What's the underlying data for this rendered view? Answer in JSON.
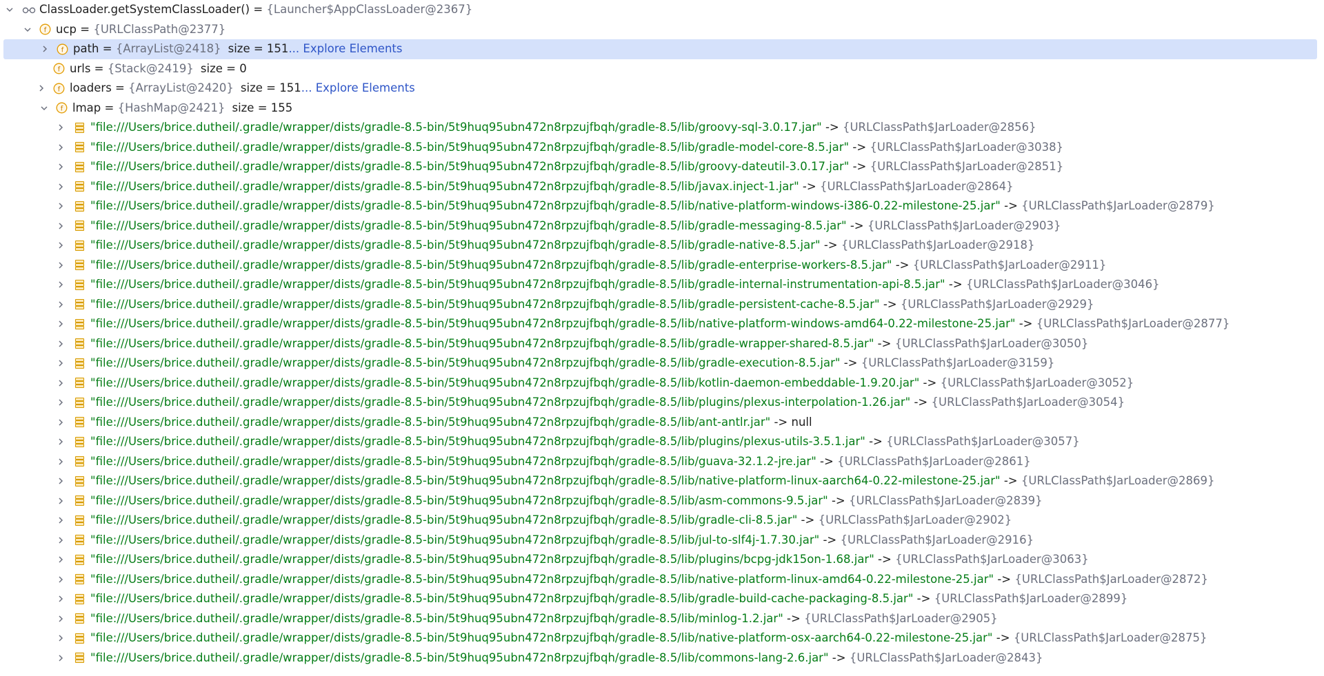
{
  "colors": {
    "selection": "#d5e1fb",
    "string": "#067d17",
    "ref": "#6c707e",
    "link": "#2e55c7",
    "field_icon": "#e39b00",
    "map_icon": "#d79b00"
  },
  "root": {
    "icon": "watch-glasses-icon",
    "name": "ClassLoader.getSystemClassLoader()",
    "eq": " = ",
    "ref": "{Launcher$AppClassLoader@2367}"
  },
  "ucp": {
    "name": "ucp",
    "eq": " = ",
    "ref": "{URLClassPath@2377}"
  },
  "fields": [
    {
      "name": "path",
      "ref": "{ArrayList@2418}",
      "size": "size = 151",
      "link": "... Explore Elements",
      "expandable": true,
      "selected": true
    },
    {
      "name": "urls",
      "ref": "{Stack@2419}",
      "size": "size = 0",
      "link": "",
      "expandable": false,
      "selected": false
    },
    {
      "name": "loaders",
      "ref": "{ArrayList@2420}",
      "size": "size = 151",
      "link": "... Explore Elements",
      "expandable": true,
      "selected": false
    }
  ],
  "lmap": {
    "name": "lmap",
    "eq": " = ",
    "ref": "{HashMap@2421}",
    "size": "size = 155"
  },
  "arrow": " -> ",
  "entries": [
    {
      "key": "\"file:///Users/brice.dutheil/.gradle/wrapper/dists/gradle-8.5-bin/5t9huq95ubn472n8rpzujfbqh/gradle-8.5/lib/groovy-sql-3.0.17.jar\"",
      "value": "{URLClassPath$JarLoader@2856}"
    },
    {
      "key": "\"file:///Users/brice.dutheil/.gradle/wrapper/dists/gradle-8.5-bin/5t9huq95ubn472n8rpzujfbqh/gradle-8.5/lib/gradle-model-core-8.5.jar\"",
      "value": "{URLClassPath$JarLoader@3038}"
    },
    {
      "key": "\"file:///Users/brice.dutheil/.gradle/wrapper/dists/gradle-8.5-bin/5t9huq95ubn472n8rpzujfbqh/gradle-8.5/lib/groovy-dateutil-3.0.17.jar\"",
      "value": "{URLClassPath$JarLoader@2851}"
    },
    {
      "key": "\"file:///Users/brice.dutheil/.gradle/wrapper/dists/gradle-8.5-bin/5t9huq95ubn472n8rpzujfbqh/gradle-8.5/lib/javax.inject-1.jar\"",
      "value": "{URLClassPath$JarLoader@2864}"
    },
    {
      "key": "\"file:///Users/brice.dutheil/.gradle/wrapper/dists/gradle-8.5-bin/5t9huq95ubn472n8rpzujfbqh/gradle-8.5/lib/native-platform-windows-i386-0.22-milestone-25.jar\"",
      "value": "{URLClassPath$JarLoader@2879}"
    },
    {
      "key": "\"file:///Users/brice.dutheil/.gradle/wrapper/dists/gradle-8.5-bin/5t9huq95ubn472n8rpzujfbqh/gradle-8.5/lib/gradle-messaging-8.5.jar\"",
      "value": "{URLClassPath$JarLoader@2903}"
    },
    {
      "key": "\"file:///Users/brice.dutheil/.gradle/wrapper/dists/gradle-8.5-bin/5t9huq95ubn472n8rpzujfbqh/gradle-8.5/lib/gradle-native-8.5.jar\"",
      "value": "{URLClassPath$JarLoader@2918}"
    },
    {
      "key": "\"file:///Users/brice.dutheil/.gradle/wrapper/dists/gradle-8.5-bin/5t9huq95ubn472n8rpzujfbqh/gradle-8.5/lib/gradle-enterprise-workers-8.5.jar\"",
      "value": "{URLClassPath$JarLoader@2911}"
    },
    {
      "key": "\"file:///Users/brice.dutheil/.gradle/wrapper/dists/gradle-8.5-bin/5t9huq95ubn472n8rpzujfbqh/gradle-8.5/lib/gradle-internal-instrumentation-api-8.5.jar\"",
      "value": "{URLClassPath$JarLoader@3046}"
    },
    {
      "key": "\"file:///Users/brice.dutheil/.gradle/wrapper/dists/gradle-8.5-bin/5t9huq95ubn472n8rpzujfbqh/gradle-8.5/lib/gradle-persistent-cache-8.5.jar\"",
      "value": "{URLClassPath$JarLoader@2929}"
    },
    {
      "key": "\"file:///Users/brice.dutheil/.gradle/wrapper/dists/gradle-8.5-bin/5t9huq95ubn472n8rpzujfbqh/gradle-8.5/lib/native-platform-windows-amd64-0.22-milestone-25.jar\"",
      "value": "{URLClassPath$JarLoader@2877}"
    },
    {
      "key": "\"file:///Users/brice.dutheil/.gradle/wrapper/dists/gradle-8.5-bin/5t9huq95ubn472n8rpzujfbqh/gradle-8.5/lib/gradle-wrapper-shared-8.5.jar\"",
      "value": "{URLClassPath$JarLoader@3050}"
    },
    {
      "key": "\"file:///Users/brice.dutheil/.gradle/wrapper/dists/gradle-8.5-bin/5t9huq95ubn472n8rpzujfbqh/gradle-8.5/lib/gradle-execution-8.5.jar\"",
      "value": "{URLClassPath$JarLoader@3159}"
    },
    {
      "key": "\"file:///Users/brice.dutheil/.gradle/wrapper/dists/gradle-8.5-bin/5t9huq95ubn472n8rpzujfbqh/gradle-8.5/lib/kotlin-daemon-embeddable-1.9.20.jar\"",
      "value": "{URLClassPath$JarLoader@3052}"
    },
    {
      "key": "\"file:///Users/brice.dutheil/.gradle/wrapper/dists/gradle-8.5-bin/5t9huq95ubn472n8rpzujfbqh/gradle-8.5/lib/plugins/plexus-interpolation-1.26.jar\"",
      "value": "{URLClassPath$JarLoader@3054}"
    },
    {
      "key": "\"file:///Users/brice.dutheil/.gradle/wrapper/dists/gradle-8.5-bin/5t9huq95ubn472n8rpzujfbqh/gradle-8.5/lib/ant-antlr.jar\"",
      "value": "null"
    },
    {
      "key": "\"file:///Users/brice.dutheil/.gradle/wrapper/dists/gradle-8.5-bin/5t9huq95ubn472n8rpzujfbqh/gradle-8.5/lib/plugins/plexus-utils-3.5.1.jar\"",
      "value": "{URLClassPath$JarLoader@3057}"
    },
    {
      "key": "\"file:///Users/brice.dutheil/.gradle/wrapper/dists/gradle-8.5-bin/5t9huq95ubn472n8rpzujfbqh/gradle-8.5/lib/guava-32.1.2-jre.jar\"",
      "value": "{URLClassPath$JarLoader@2861}"
    },
    {
      "key": "\"file:///Users/brice.dutheil/.gradle/wrapper/dists/gradle-8.5-bin/5t9huq95ubn472n8rpzujfbqh/gradle-8.5/lib/native-platform-linux-aarch64-0.22-milestone-25.jar\"",
      "value": "{URLClassPath$JarLoader@2869}"
    },
    {
      "key": "\"file:///Users/brice.dutheil/.gradle/wrapper/dists/gradle-8.5-bin/5t9huq95ubn472n8rpzujfbqh/gradle-8.5/lib/asm-commons-9.5.jar\"",
      "value": "{URLClassPath$JarLoader@2839}"
    },
    {
      "key": "\"file:///Users/brice.dutheil/.gradle/wrapper/dists/gradle-8.5-bin/5t9huq95ubn472n8rpzujfbqh/gradle-8.5/lib/gradle-cli-8.5.jar\"",
      "value": "{URLClassPath$JarLoader@2902}"
    },
    {
      "key": "\"file:///Users/brice.dutheil/.gradle/wrapper/dists/gradle-8.5-bin/5t9huq95ubn472n8rpzujfbqh/gradle-8.5/lib/jul-to-slf4j-1.7.30.jar\"",
      "value": "{URLClassPath$JarLoader@2916}"
    },
    {
      "key": "\"file:///Users/brice.dutheil/.gradle/wrapper/dists/gradle-8.5-bin/5t9huq95ubn472n8rpzujfbqh/gradle-8.5/lib/plugins/bcpg-jdk15on-1.68.jar\"",
      "value": "{URLClassPath$JarLoader@3063}"
    },
    {
      "key": "\"file:///Users/brice.dutheil/.gradle/wrapper/dists/gradle-8.5-bin/5t9huq95ubn472n8rpzujfbqh/gradle-8.5/lib/native-platform-linux-amd64-0.22-milestone-25.jar\"",
      "value": "{URLClassPath$JarLoader@2872}"
    },
    {
      "key": "\"file:///Users/brice.dutheil/.gradle/wrapper/dists/gradle-8.5-bin/5t9huq95ubn472n8rpzujfbqh/gradle-8.5/lib/gradle-build-cache-packaging-8.5.jar\"",
      "value": "{URLClassPath$JarLoader@2899}"
    },
    {
      "key": "\"file:///Users/brice.dutheil/.gradle/wrapper/dists/gradle-8.5-bin/5t9huq95ubn472n8rpzujfbqh/gradle-8.5/lib/minlog-1.2.jar\"",
      "value": "{URLClassPath$JarLoader@2905}"
    },
    {
      "key": "\"file:///Users/brice.dutheil/.gradle/wrapper/dists/gradle-8.5-bin/5t9huq95ubn472n8rpzujfbqh/gradle-8.5/lib/native-platform-osx-aarch64-0.22-milestone-25.jar\"",
      "value": "{URLClassPath$JarLoader@2875}"
    },
    {
      "key": "\"file:///Users/brice.dutheil/.gradle/wrapper/dists/gradle-8.5-bin/5t9huq95ubn472n8rpzujfbqh/gradle-8.5/lib/commons-lang-2.6.jar\"",
      "value": "{URLClassPath$JarLoader@2843}"
    }
  ]
}
